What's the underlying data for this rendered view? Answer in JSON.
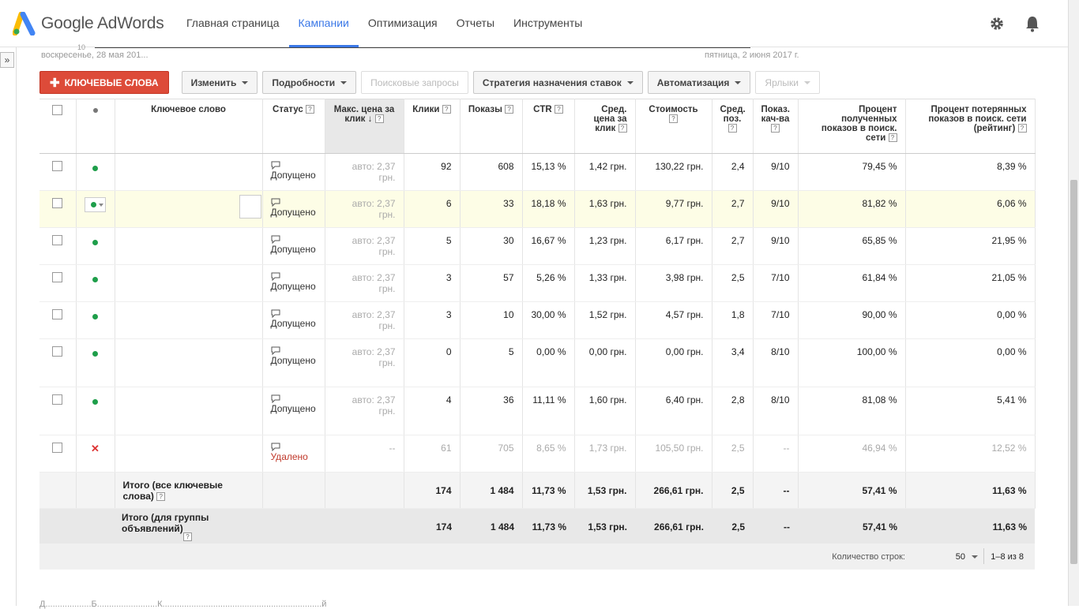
{
  "app": {
    "logo_text": "Google AdWords"
  },
  "nav": {
    "items": [
      "Главная страница",
      "Кампании",
      "Оптимизация",
      "Отчеты",
      "Инструменты"
    ],
    "active": "Кампании"
  },
  "dates": {
    "left": "воскресенье, 28 мая 201...",
    "right": "пятница, 2 июня 2017 г.",
    "tiny": "10"
  },
  "toolbar": {
    "add_keywords": "КЛЮЧЕВЫЕ СЛОВА",
    "edit": "Изменить",
    "details": "Подробности",
    "search_terms": "Поисковые запросы",
    "bid_strategy": "Стратегия назначения ставок",
    "automation": "Автоматизация",
    "labels": "Ярлыки"
  },
  "columns": {
    "keyword": "Ключевое слово",
    "status": "Статус",
    "max_cpc": "Макс. цена за клик",
    "clicks": "Клики",
    "impressions": "Показы",
    "ctr": "CTR",
    "avg_cpc": "Сред. цена за клик",
    "cost": "Стоимость",
    "avg_pos": "Сред. поз.",
    "quality": "Показ. кач-ва",
    "search_is": "Процент полученных показов в поиск. сети",
    "search_lost_is": "Процент потерянных показов в поиск. сети (рейтинг)"
  },
  "rows": [
    {
      "state": "enabled",
      "status": "Допущено",
      "max_cpc": "авто: 2,37 грн.",
      "clicks": "92",
      "impr": "608",
      "ctr": "15,13 %",
      "avg_cpc": "1,42 грн.",
      "cost": "130,22 грн.",
      "pos": "2,4",
      "qs": "9/10",
      "is": "79,45 %",
      "lost": "8,39 %"
    },
    {
      "state": "enabled",
      "status": "Допущено",
      "max_cpc": "авто: 2,37 грн.",
      "clicks": "6",
      "impr": "33",
      "ctr": "18,18 %",
      "avg_cpc": "1,63 грн.",
      "cost": "9,77 грн.",
      "pos": "2,7",
      "qs": "9/10",
      "is": "81,82 %",
      "lost": "6,06 %"
    },
    {
      "state": "enabled",
      "status": "Допущено",
      "max_cpc": "авто: 2,37 грн.",
      "clicks": "5",
      "impr": "30",
      "ctr": "16,67 %",
      "avg_cpc": "1,23 грн.",
      "cost": "6,17 грн.",
      "pos": "2,7",
      "qs": "9/10",
      "is": "65,85 %",
      "lost": "21,95 %"
    },
    {
      "state": "enabled",
      "status": "Допущено",
      "max_cpc": "авто: 2,37 грн.",
      "clicks": "3",
      "impr": "57",
      "ctr": "5,26 %",
      "avg_cpc": "1,33 грн.",
      "cost": "3,98 грн.",
      "pos": "2,5",
      "qs": "7/10",
      "is": "61,84 %",
      "lost": "21,05 %"
    },
    {
      "state": "enabled",
      "status": "Допущено",
      "max_cpc": "авто: 2,37 грн.",
      "clicks": "3",
      "impr": "10",
      "ctr": "30,00 %",
      "avg_cpc": "1,52 грн.",
      "cost": "4,57 грн.",
      "pos": "1,8",
      "qs": "7/10",
      "is": "90,00 %",
      "lost": "0,00 %"
    },
    {
      "state": "enabled",
      "status": "Допущено",
      "max_cpc": "авто: 2,37 грн.",
      "clicks": "0",
      "impr": "5",
      "ctr": "0,00 %",
      "avg_cpc": "0,00 грн.",
      "cost": "0,00 грн.",
      "pos": "3,4",
      "qs": "8/10",
      "is": "100,00 %",
      "lost": "0,00 %"
    },
    {
      "state": "enabled",
      "status": "Допущено",
      "max_cpc": "авто: 2,37 грн.",
      "clicks": "4",
      "impr": "36",
      "ctr": "11,11 %",
      "avg_cpc": "1,60 грн.",
      "cost": "6,40 грн.",
      "pos": "2,8",
      "qs": "8/10",
      "is": "81,08 %",
      "lost": "5,41 %"
    },
    {
      "state": "removed",
      "status": "Удалено",
      "max_cpc": "--",
      "clicks": "61",
      "impr": "705",
      "ctr": "8,65 %",
      "avg_cpc": "1,73 грн.",
      "cost": "105,50 грн.",
      "pos": "2,5",
      "qs": "--",
      "is": "46,94 %",
      "lost": "12,52 %"
    }
  ],
  "total_all": {
    "label": "Итого (все ключевые слова)",
    "clicks": "174",
    "impr": "1 484",
    "ctr": "11,73 %",
    "avg_cpc": "1,53 грн.",
    "cost": "266,61 грн.",
    "pos": "2,5",
    "qs": "--",
    "is": "57,41 %",
    "lost": "11,63 %"
  },
  "total_group": {
    "label": "Итого (для группы объявлений)",
    "clicks": "174",
    "impr": "1 484",
    "ctr": "11,73 %",
    "avg_cpc": "1,53 грн.",
    "cost": "266,61 грн.",
    "pos": "2,5",
    "qs": "--",
    "is": "57,41 %",
    "lost": "11,63 %"
  },
  "footer": {
    "rows_label": "Количество строк:",
    "rows_value": "50",
    "range": "1–8 из 8"
  },
  "bottom_text": "Д...................Б.........................К..................................................................й",
  "colors": {
    "accent": "#3b78e7",
    "primary_button": "#dd4b39",
    "enabled_dot": "#1e9e4a",
    "removed": "#d33"
  }
}
